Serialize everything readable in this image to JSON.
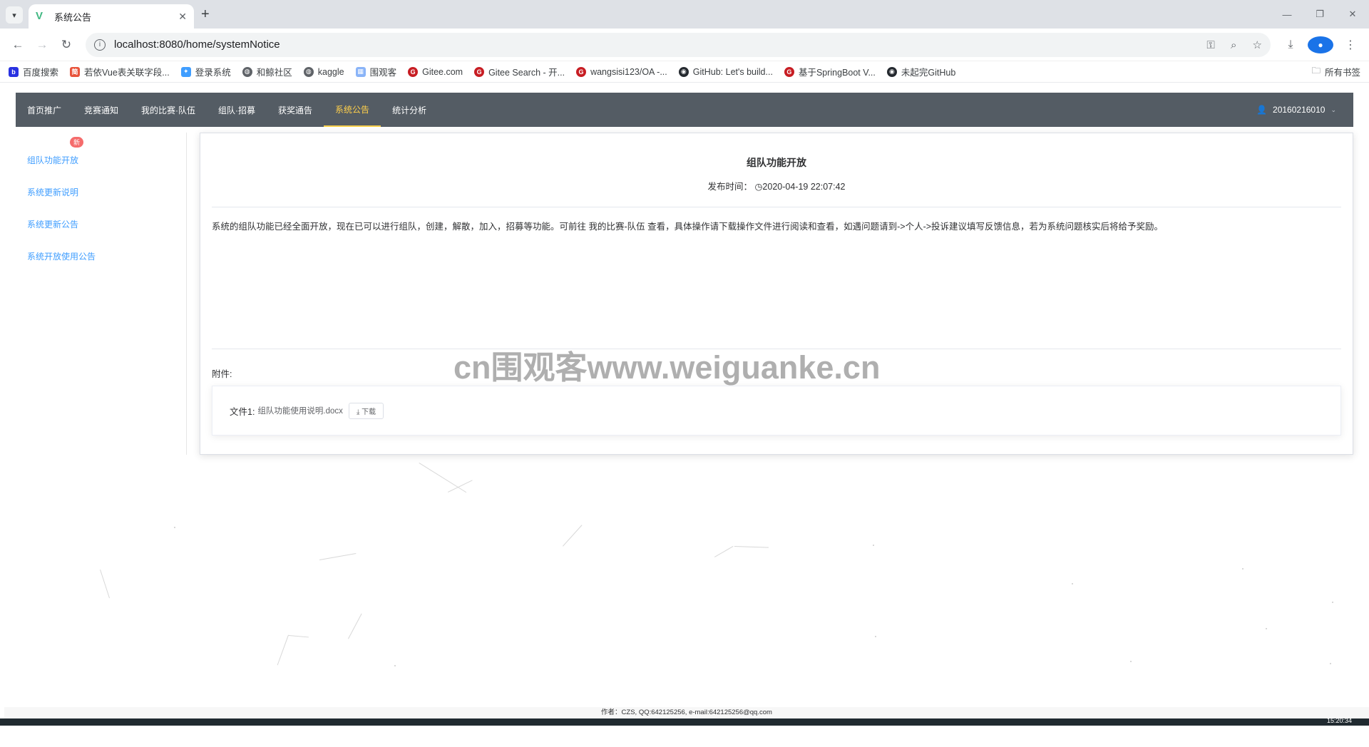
{
  "browser": {
    "tab_title": "系统公告",
    "url": "localhost:8080/home/systemNotice",
    "bookmarks": [
      "百度搜索",
      "若依Vue表关联字段...",
      "登录系统",
      "和鲸社区",
      "kaggle",
      "围观客",
      "Gitee.com",
      "Gitee Search - 开...",
      "wangsisi123/OA -...",
      "GitHub: Let's build...",
      "基于SpringBoot V...",
      "未起完GitHub"
    ],
    "all_bookmarks": "所有书签"
  },
  "nav": {
    "items": [
      "首页推广",
      "竞赛通知",
      "我的比赛·队伍",
      "组队·招募",
      "获奖通告",
      "系统公告",
      "统计分析"
    ],
    "active": "系统公告",
    "username": "20160216010"
  },
  "sidebar": {
    "badge": "新",
    "items": [
      "组队功能开放",
      "系统更新说明",
      "系统更新公告",
      "系统开放使用公告"
    ]
  },
  "notice": {
    "title": "组队功能开放",
    "time_label": "发布时间：",
    "time_value": "2020-04-19 22:07:42",
    "body": "系统的组队功能已经全面开放，现在已可以进行组队，创建，解散，加入，招募等功能。可前往 我的比赛-队伍 查看，具体操作请下载操作文件进行阅读和查看，如遇问题请到->个人->投诉建议填写反馈信息，若为系统问题核实后将给予奖励。",
    "attachment_label": "附件:",
    "file_label": "文件1:",
    "file_name": "组队功能使用说明.docx",
    "download_label": "下载"
  },
  "watermark": "cn围观客www.weiguanke.cn",
  "footer": "作者：CZS, QQ:642125256, e-mail:642125256@qq.com",
  "taskbar_time": "15:20:34"
}
